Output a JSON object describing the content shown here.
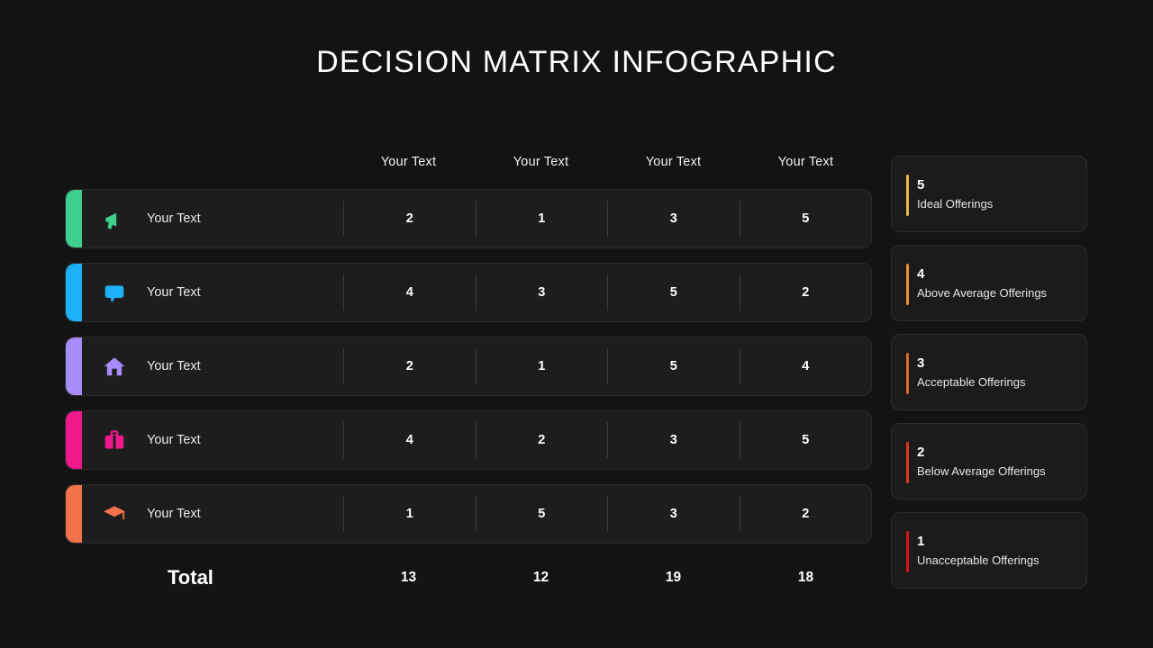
{
  "title": "DECISION MATRIX INFOGRAPHIC",
  "matrix": {
    "column_headers": [
      "Your Text",
      "Your Text",
      "Your Text",
      "Your Text"
    ],
    "rows": [
      {
        "label": "Your Text",
        "icon": "megaphone-icon",
        "accent_color": "#3ecf8e",
        "values": [
          "2",
          "1",
          "3",
          "5"
        ]
      },
      {
        "label": "Your Text",
        "icon": "speech-bubble-icon",
        "accent_color": "#1cb0f6",
        "values": [
          "4",
          "3",
          "5",
          "2"
        ]
      },
      {
        "label": "Your Text",
        "icon": "home-icon",
        "accent_color": "#a78bfa",
        "values": [
          "2",
          "1",
          "5",
          "4"
        ]
      },
      {
        "label": "Your Text",
        "icon": "briefcase-icon",
        "accent_color": "#f0188c",
        "values": [
          "4",
          "2",
          "3",
          "5"
        ]
      },
      {
        "label": "Your Text",
        "icon": "graduation-cap-icon",
        "accent_color": "#f2724a",
        "values": [
          "1",
          "5",
          "3",
          "2"
        ]
      }
    ],
    "total_label": "Total",
    "totals": [
      "13",
      "12",
      "19",
      "18"
    ]
  },
  "legend": {
    "items": [
      {
        "score": "5",
        "text": "Ideal Offerings",
        "color": "#e8b93a"
      },
      {
        "score": "4",
        "text": "Above Average Offerings",
        "color": "#e8932a"
      },
      {
        "score": "3",
        "text": "Acceptable  Offerings",
        "color": "#e06a28"
      },
      {
        "score": "2",
        "text": "Below Average Offerings",
        "color": "#d93a1e"
      },
      {
        "score": "1",
        "text": "Unacceptable  Offerings",
        "color": "#d41414"
      }
    ]
  },
  "chart_data": {
    "type": "table",
    "title": "DECISION MATRIX INFOGRAPHIC",
    "categories": [
      "Your Text",
      "Your Text",
      "Your Text",
      "Your Text"
    ],
    "series": [
      {
        "name": "Your Text",
        "values": [
          2,
          1,
          3,
          5
        ]
      },
      {
        "name": "Your Text",
        "values": [
          4,
          3,
          5,
          2
        ]
      },
      {
        "name": "Your Text",
        "values": [
          2,
          1,
          5,
          4
        ]
      },
      {
        "name": "Your Text",
        "values": [
          4,
          2,
          3,
          5
        ]
      },
      {
        "name": "Your Text",
        "values": [
          1,
          5,
          3,
          2
        ]
      }
    ],
    "totals": [
      13,
      12,
      19,
      18
    ],
    "scale": [
      {
        "value": 5,
        "label": "Ideal Offerings"
      },
      {
        "value": 4,
        "label": "Above Average Offerings"
      },
      {
        "value": 3,
        "label": "Acceptable  Offerings"
      },
      {
        "value": 2,
        "label": "Below Average Offerings"
      },
      {
        "value": 1,
        "label": "Unacceptable  Offerings"
      }
    ]
  }
}
